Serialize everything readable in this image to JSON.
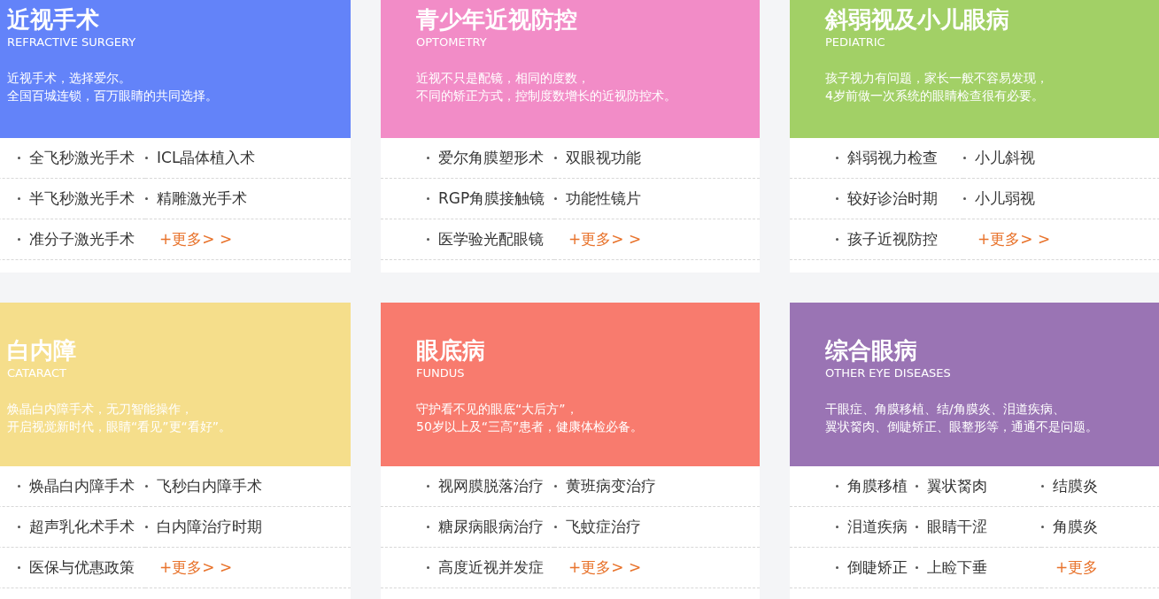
{
  "sections": [
    {
      "title": "近视手术",
      "subtitle": "REFRACTIVE SURGERY",
      "color": "#6383f9",
      "description": [
        "近视手术，选择爱尔。",
        "全国百城连锁，百万眼睛的共同选择。"
      ],
      "links": [
        {
          "kind": "item",
          "label": "全飞秒激光手术"
        },
        {
          "kind": "item",
          "label": "ICL晶体植入术"
        },
        {
          "kind": "item",
          "label": "半飞秒激光手术"
        },
        {
          "kind": "item",
          "label": "精雕激光手术"
        },
        {
          "kind": "item",
          "label": "准分子激光手术"
        },
        {
          "kind": "more",
          "label": "+更多> >"
        }
      ]
    },
    {
      "title": "青少年近视防控",
      "subtitle": "OPTOMETRY",
      "color": "#f28cc7",
      "description": [
        "近视不只是配镜，相同的度数，",
        "不同的矫正方式，控制度数增长的近视防控术。"
      ],
      "links": [
        {
          "kind": "item",
          "label": "爱尔角膜塑形术"
        },
        {
          "kind": "item",
          "label": "双眼视功能"
        },
        {
          "kind": "item",
          "label": "RGP角膜接触镜"
        },
        {
          "kind": "item",
          "label": "功能性镜片"
        },
        {
          "kind": "item",
          "label": "医学验光配眼镜"
        },
        {
          "kind": "more",
          "label": "+更多> >"
        }
      ]
    },
    {
      "title": "斜弱视及小儿眼病",
      "subtitle": "PEDIATRIC",
      "color": "#a2d066",
      "description": [
        "孩子视力有问题，家长一般不容易发现，",
        "4岁前做一次系统的眼睛检查很有必要。"
      ],
      "links": [
        {
          "kind": "item",
          "label": "斜弱视力检查"
        },
        {
          "kind": "item",
          "label": "小儿斜视"
        },
        {
          "kind": "item",
          "label": "较好诊治时期"
        },
        {
          "kind": "item",
          "label": "小儿弱视"
        },
        {
          "kind": "item",
          "label": "孩子近视防控"
        },
        {
          "kind": "more",
          "label": "+更多> >"
        }
      ]
    },
    {
      "title": "白内障",
      "subtitle": "CATARACT",
      "color": "#f5de8b",
      "description": [
        "焕晶白内障手术，无刀智能操作，",
        "开启视觉新时代，眼睛“看见”更“看好”。"
      ],
      "links": [
        {
          "kind": "item",
          "label": "焕晶白内障手术"
        },
        {
          "kind": "item",
          "label": "飞秒白内障手术"
        },
        {
          "kind": "item",
          "label": "超声乳化术手术"
        },
        {
          "kind": "item",
          "label": "白内障治疗时期"
        },
        {
          "kind": "item",
          "label": "医保与优惠政策"
        },
        {
          "kind": "more",
          "label": "+更多> >"
        }
      ]
    },
    {
      "title": "眼底病",
      "subtitle": "FUNDUS",
      "color": "#f87b6e",
      "description": [
        "守护看不见的眼底“大后方”，",
        "50岁以上及“三高”患者，健康体检必备。"
      ],
      "links": [
        {
          "kind": "item",
          "label": "视网膜脱落治疗"
        },
        {
          "kind": "item",
          "label": "黄班病变治疗"
        },
        {
          "kind": "item",
          "label": "糖尿病眼病治疗"
        },
        {
          "kind": "item",
          "label": "飞蚊症治疗"
        },
        {
          "kind": "item",
          "label": "高度近视并发症"
        },
        {
          "kind": "more",
          "label": "+更多> >"
        }
      ]
    },
    {
      "title": "综合眼病",
      "subtitle": "OTHER EYE DISEASES",
      "color": "#9a74b4",
      "description": [
        "干眼症、角膜移植、结/角膜炎、泪道疾病、",
        "翼状胬肉、倒睫矫正、眼整形等，通通不是问题。"
      ],
      "links": [
        {
          "kind": "item",
          "label": "角膜移植"
        },
        {
          "kind": "item",
          "label": "翼状胬肉"
        },
        {
          "kind": "item",
          "label": "结膜炎"
        },
        {
          "kind": "item",
          "label": "泪道疾病"
        },
        {
          "kind": "item",
          "label": "眼睛干涩"
        },
        {
          "kind": "item",
          "label": "角膜炎"
        },
        {
          "kind": "item",
          "label": "倒睫矫正"
        },
        {
          "kind": "item",
          "label": "上睑下垂"
        },
        {
          "kind": "more",
          "label": "+更多"
        }
      ]
    }
  ]
}
